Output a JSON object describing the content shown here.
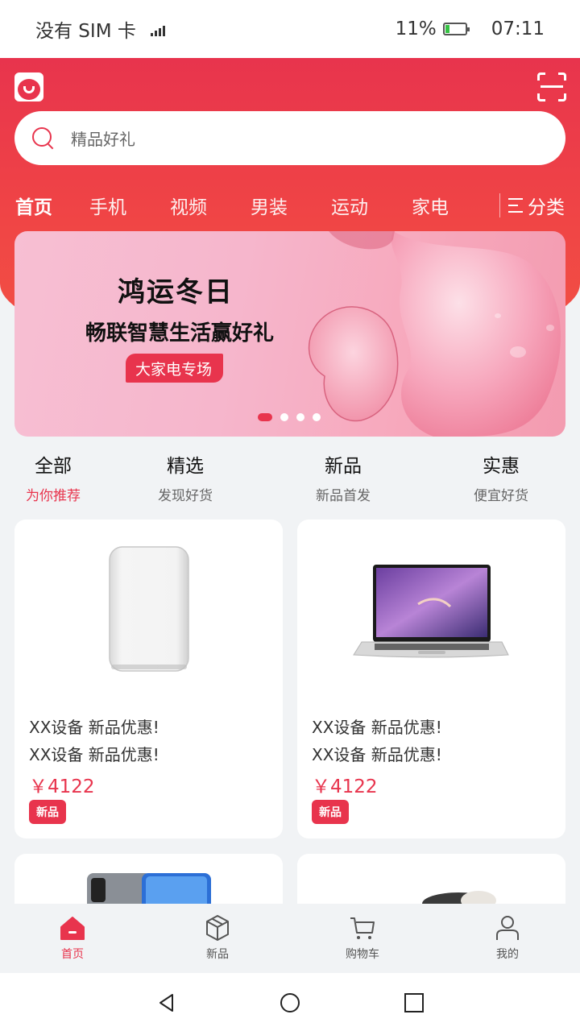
{
  "status": {
    "carrier": "没有 SIM 卡",
    "battery": "11%",
    "time": "07:11"
  },
  "search": {
    "placeholder": "精品好礼"
  },
  "nav": {
    "tabs": [
      "首页",
      "手机",
      "视频",
      "男装",
      "运动",
      "家电"
    ],
    "category_label": "分类"
  },
  "banner": {
    "title": "鸿运冬日",
    "subtitle": "畅联智慧生活赢好礼",
    "tag": "大家电专场",
    "dot_count": 4,
    "active_dot": 0
  },
  "categories": [
    {
      "title": "全部",
      "subtitle": "为你推荐"
    },
    {
      "title": "精选",
      "subtitle": "发现好货"
    },
    {
      "title": "新品",
      "subtitle": "新品首发"
    },
    {
      "title": "实惠",
      "subtitle": "便宜好货"
    }
  ],
  "products": [
    {
      "line1": "XX设备 新品优惠!",
      "line2": "XX设备 新品优惠!",
      "price": "￥4122",
      "badge": "新品",
      "image": "power-bank"
    },
    {
      "line1": "XX设备 新品优惠!",
      "line2": "XX设备 新品优惠!",
      "price": "￥4122",
      "badge": "新品",
      "image": "laptop"
    }
  ],
  "tabbar": [
    {
      "label": "首页",
      "icon": "home-icon"
    },
    {
      "label": "新品",
      "icon": "box-icon"
    },
    {
      "label": "购物车",
      "icon": "cart-icon"
    },
    {
      "label": "我的",
      "icon": "user-icon"
    }
  ],
  "colors": {
    "accent": "#e8344d",
    "header": "#f04545",
    "background": "#f1f3f5"
  }
}
